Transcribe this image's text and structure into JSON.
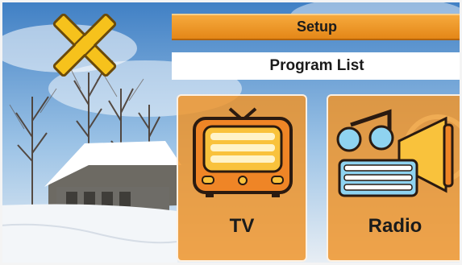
{
  "header": {
    "setup_label": "Setup",
    "program_list_label": "Program List"
  },
  "cards": {
    "tv": {
      "label": "TV",
      "icon": "tv-icon"
    },
    "radio": {
      "label": "Radio",
      "icon": "radio-icon"
    }
  },
  "close": {
    "icon": "close-icon"
  },
  "colors": {
    "accent": "#f0922a",
    "bar_text": "#1b1b1b",
    "list_bar": "#ffffff"
  }
}
